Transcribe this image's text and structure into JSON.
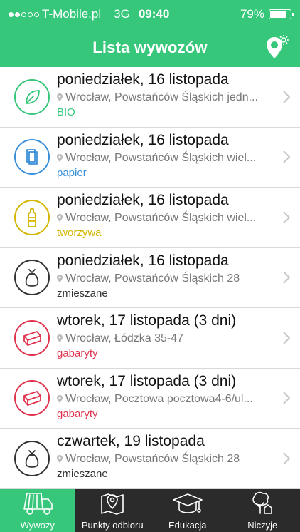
{
  "status_bar": {
    "carrier": "T-Mobile.pl",
    "network": "3G",
    "time": "09:40",
    "battery": "79%",
    "battery_level": 0.79
  },
  "header": {
    "title": "Lista wywozów",
    "action_icon": "location-settings-icon"
  },
  "colors": {
    "accent": "#37c77a",
    "bio": "#37c77a",
    "papier": "#3a8fd9",
    "tworzywa": "#d4b600",
    "zmieszane": "#333333",
    "gabaryty": "#e0334f",
    "tabbar": "#2b2b2b"
  },
  "items": [
    {
      "date": "poniedziałek, 16 listopada",
      "address": "Wrocław, Powstańców Śląskich jedn...",
      "type": "BIO",
      "icon": "leaf-icon",
      "color": "#37c77a"
    },
    {
      "date": "poniedziałek, 16 listopada",
      "address": "Wrocław, Powstańców Śląskich wiel...",
      "type": "papier",
      "icon": "paper-icon",
      "color": "#3a8fd9"
    },
    {
      "date": "poniedziałek, 16 listopada",
      "address": "Wrocław, Powstańców Śląskich wiel...",
      "type": "tworzywa",
      "icon": "bottle-icon",
      "color": "#d4b600"
    },
    {
      "date": "poniedziałek, 16 listopada",
      "address": "Wrocław, Powstańców Śląskich 28",
      "type": "zmieszane",
      "icon": "trash-bag-icon",
      "color": "#333333"
    },
    {
      "date": "wtorek, 17 listopada (3 dni)",
      "address": "Wrocław, Łódzka 35-47",
      "type": "gabaryty",
      "icon": "bulky-waste-icon",
      "color": "#e0334f"
    },
    {
      "date": "wtorek, 17 listopada (3 dni)",
      "address": "Wrocław, Pocztowa pocztowa4-6/ul...",
      "type": "gabaryty",
      "icon": "bulky-waste-icon",
      "color": "#e0334f"
    },
    {
      "date": "czwartek, 19 listopada",
      "address": "Wrocław, Powstańców Śląskich 28",
      "type": "zmieszane",
      "icon": "trash-bag-icon",
      "color": "#333333"
    }
  ],
  "tabs": [
    {
      "label": "Wywozy",
      "icon": "garbage-truck-icon",
      "active": true
    },
    {
      "label": "Punkty odbioru",
      "icon": "map-pin-icon",
      "active": false
    },
    {
      "label": "Edukacja",
      "icon": "graduation-cap-icon",
      "active": false
    },
    {
      "label": "Niczyje",
      "icon": "tree-house-icon",
      "active": false
    }
  ]
}
